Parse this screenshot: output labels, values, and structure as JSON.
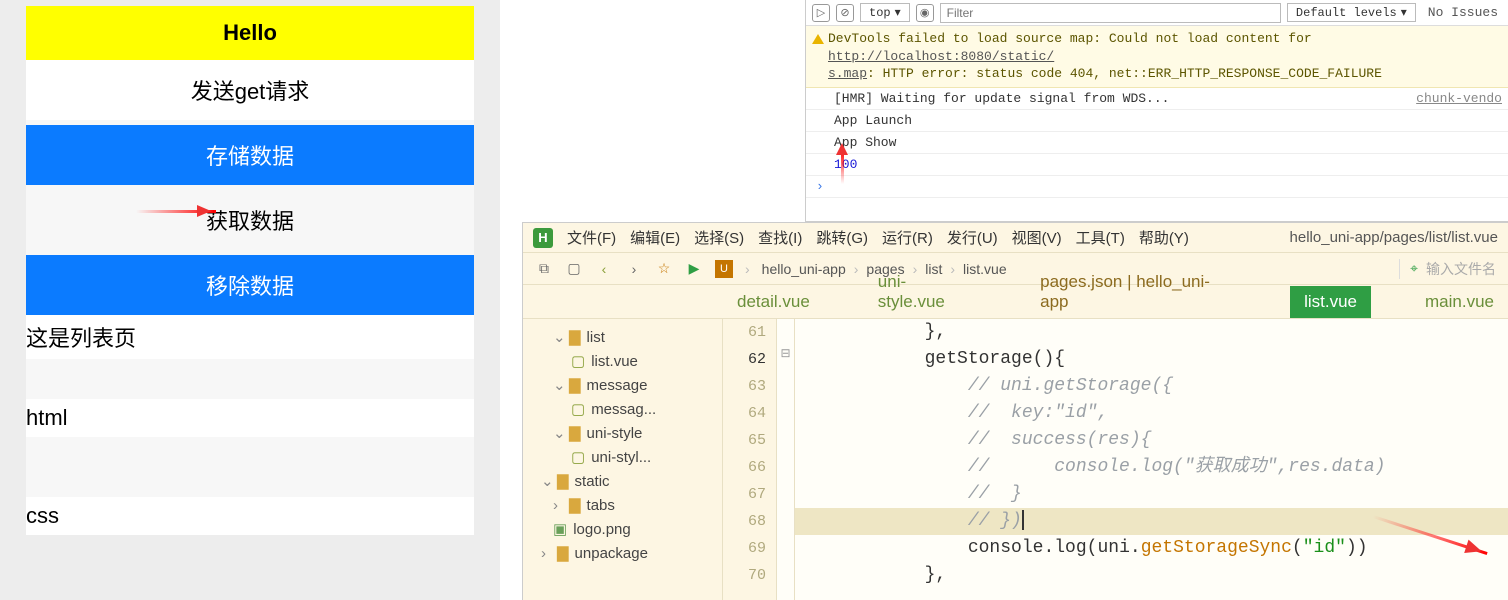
{
  "phone": {
    "hello": "Hello",
    "btn_get": "发送get请求",
    "btn_store": "存储数据",
    "btn_fetch": "获取数据",
    "btn_remove": "移除数据",
    "list_label": "这是列表页",
    "item_html": "html",
    "item_css": "css"
  },
  "devtools": {
    "top": "top",
    "filter_ph": "Filter",
    "levels": "Default levels",
    "issues": "No Issues",
    "warn_prefix": "DevTools failed to load source map: Could not load content for ",
    "warn_url": "http://localhost:8080/static/",
    "warn_line2": "s.map",
    "warn_line2b": ": HTTP error: status code 404, net::ERR_HTTP_RESPONSE_CODE_FAILURE",
    "row1": "[HMR] Waiting for update signal from WDS...",
    "row1_src": "chunk-vendo",
    "row2": "App Launch",
    "row3": "App Show",
    "row4": "100"
  },
  "ide": {
    "menu": [
      "文件(F)",
      "编辑(E)",
      "选择(S)",
      "查找(I)",
      "跳转(G)",
      "运行(R)",
      "发行(U)",
      "视图(V)",
      "工具(T)",
      "帮助(Y)"
    ],
    "title": "hello_uni-app/pages/list/list.vue",
    "crumbs": [
      "hello_uni-app",
      "pages",
      "list",
      "list.vue"
    ],
    "search_ph": "输入文件名",
    "tabs": {
      "t1": "detail.vue",
      "t2": "uni-style.vue",
      "t3": "pages.json | hello_uni-app",
      "t4": "list.vue",
      "t5": "main.vue"
    },
    "tree": {
      "list": "list",
      "listfile": "list.vue",
      "message": "message",
      "messagefile": "messag...",
      "unistyle": "uni-style",
      "unistylefile": "uni-styl...",
      "static": "static",
      "tabs": "tabs",
      "logo": "logo.png",
      "unpackage": "unpackage"
    },
    "lines": {
      "n61": "61",
      "n62": "62",
      "n63": "63",
      "n64": "64",
      "n65": "65",
      "n66": "66",
      "n67": "67",
      "n68": "68",
      "n69": "69",
      "n70": "70",
      "l61": "            },",
      "l62": "            getStorage(){",
      "l63": "                // uni.getStorage({",
      "l64": "                //  key:\"id\",",
      "l65": "                //  success(res){",
      "l66": "                //      console.log(\"获取成功\",res.data)",
      "l67": "                //  }",
      "l68": "                // })",
      "l69a": "                console",
      "l69b": ".log(",
      "l69c": "uni",
      "l69d": ".",
      "l69e": "getStorageSync",
      "l69f": "(",
      "l69g": "\"id\"",
      "l69h": "))",
      "l70": "            },"
    }
  }
}
